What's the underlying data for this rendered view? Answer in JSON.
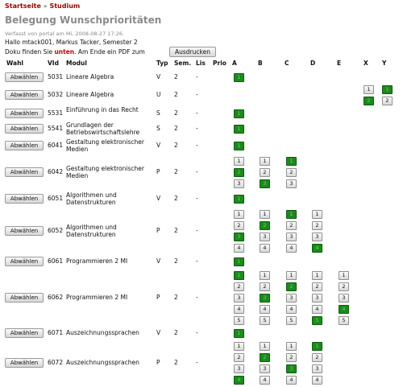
{
  "breadcrumb": {
    "home": "Startseite",
    "separator": "»",
    "current": "Studium"
  },
  "page_title": "Belegung Wunschprioritäten",
  "meta": "Verfasst von portal am Mi, 2008-08-27 17:26.",
  "hello": "Hallo mtack001, Markus Tacker, Semester 2",
  "doku": {
    "before": "Doku finden Sie ",
    "link": "unten",
    "after": ". Am Ende ein PDF zum",
    "print_button": "Ausdrucken"
  },
  "headers": {
    "wahl": "Wahl",
    "vid": "VId",
    "modul": "Modul",
    "typ": "Typ",
    "sem": "Sem.",
    "lis": "Lis",
    "prio": "Prio",
    "a": "A",
    "b": "B",
    "c": "C",
    "d": "D",
    "e": "E",
    "x": "X",
    "y": "Y"
  },
  "rows": [
    {
      "button": "Abwählen",
      "vid": "5031",
      "modul": "Lineare Algebra",
      "typ": "V",
      "sem": "2",
      "lis": "-",
      "groups": {
        "a": {
          "options": [
            "1"
          ],
          "selected": "1"
        }
      }
    },
    {
      "button": "Abwählen",
      "vid": "5032",
      "modul": "Lineare Algebra",
      "typ": "U",
      "sem": "2",
      "lis": "-",
      "groups": {
        "x": {
          "options": [
            "1",
            "2"
          ],
          "selected": "2"
        },
        "y": {
          "options": [
            "1",
            "2"
          ],
          "selected": "1"
        }
      }
    },
    {
      "button": "Abwählen",
      "vid": "5531",
      "modul": "Einführung in das Recht",
      "typ": "S",
      "sem": "2",
      "lis": "-",
      "groups": {
        "a": {
          "options": [
            "1"
          ],
          "selected": "1"
        }
      }
    },
    {
      "button": "Abwählen",
      "vid": "5541",
      "modul": "Grundlagen der Betriebswirtschaftslehre",
      "typ": "S",
      "sem": "2",
      "lis": "-",
      "groups": {
        "a": {
          "options": [
            "1"
          ],
          "selected": "1"
        }
      }
    },
    {
      "button": "Abwählen",
      "vid": "6041",
      "modul": "Gestaltung elektronischer Medien",
      "typ": "V",
      "sem": "2",
      "lis": "-",
      "groups": {
        "a": {
          "options": [
            "1"
          ],
          "selected": "1"
        }
      }
    },
    {
      "button": "Abwählen",
      "vid": "6042",
      "modul": "Gestaltung elektronischer Medien",
      "typ": "P",
      "sem": "2",
      "lis": "-",
      "groups": {
        "a": {
          "options": [
            "1",
            "2",
            "3"
          ],
          "selected": "2"
        },
        "b": {
          "options": [
            "1",
            "2",
            "3"
          ],
          "selected": "3"
        },
        "c": {
          "options": [
            "1",
            "2",
            "3"
          ],
          "selected": "1"
        }
      }
    },
    {
      "button": "Abwählen",
      "vid": "6051",
      "modul": "Algorithmen und Datenstrukturen",
      "typ": "V",
      "sem": "2",
      "lis": "-",
      "groups": {
        "a": {
          "options": [
            "1"
          ],
          "selected": "1"
        }
      }
    },
    {
      "button": "Abwählen",
      "vid": "6052",
      "modul": "Algorithmen und Datenstrukturen",
      "typ": "P",
      "sem": "2",
      "lis": "-",
      "groups": {
        "a": {
          "options": [
            "1",
            "2",
            "3",
            "4"
          ],
          "selected": "3"
        },
        "b": {
          "options": [
            "1",
            "2",
            "3",
            "4"
          ],
          "selected": "2"
        },
        "c": {
          "options": [
            "1",
            "2",
            "3",
            "4"
          ],
          "selected": "1"
        },
        "d": {
          "options": [
            "1",
            "2",
            "3",
            "4"
          ],
          "selected": "4"
        }
      }
    },
    {
      "button": "Abwählen",
      "vid": "6061",
      "modul": "Programmieren 2 MI",
      "typ": "V",
      "sem": "2",
      "lis": "-",
      "groups": {
        "a": {
          "options": [
            "1"
          ],
          "selected": "1"
        }
      }
    },
    {
      "button": "Abwählen",
      "vid": "6062",
      "modul": "Programmieren 2 MI",
      "typ": "P",
      "sem": "2",
      "lis": "-",
      "groups": {
        "a": {
          "options": [
            "1",
            "2",
            "3",
            "4",
            "5"
          ],
          "selected": "1"
        },
        "b": {
          "options": [
            "1",
            "2",
            "3",
            "4",
            "5"
          ],
          "selected": "3"
        },
        "c": {
          "options": [
            "1",
            "2",
            "3",
            "4",
            "5"
          ],
          "selected": "2"
        },
        "d": {
          "options": [
            "1",
            "2",
            "3",
            "4",
            "5"
          ],
          "selected": "5"
        },
        "e": {
          "options": [
            "1",
            "2",
            "3",
            "4",
            "5"
          ],
          "selected": "4"
        }
      }
    },
    {
      "button": "Abwählen",
      "vid": "6071",
      "modul": "Auszeichnungssprachen",
      "typ": "V",
      "sem": "2",
      "lis": "-",
      "groups": {
        "a": {
          "options": [
            "1"
          ],
          "selected": "1"
        }
      }
    },
    {
      "button": "Abwählen",
      "vid": "6072",
      "modul": "Auszeichnungssprachen",
      "typ": "P",
      "sem": "2",
      "lis": "-",
      "groups": {
        "a": {
          "options": [
            "1",
            "2",
            "3",
            "4"
          ],
          "selected": "4"
        },
        "b": {
          "options": [
            "1",
            "2",
            "3",
            "4"
          ],
          "selected": "2"
        },
        "c": {
          "options": [
            "1",
            "2",
            "3",
            "4"
          ],
          "selected": "3"
        },
        "d": {
          "options": [
            "1",
            "2",
            "3",
            "4"
          ],
          "selected": "1"
        }
      }
    }
  ],
  "colors": {
    "breadcrumb": "#a00000",
    "selected_priority": "#1d8a1d",
    "doku_link": "#c00000",
    "title": "#8a8a8a"
  }
}
